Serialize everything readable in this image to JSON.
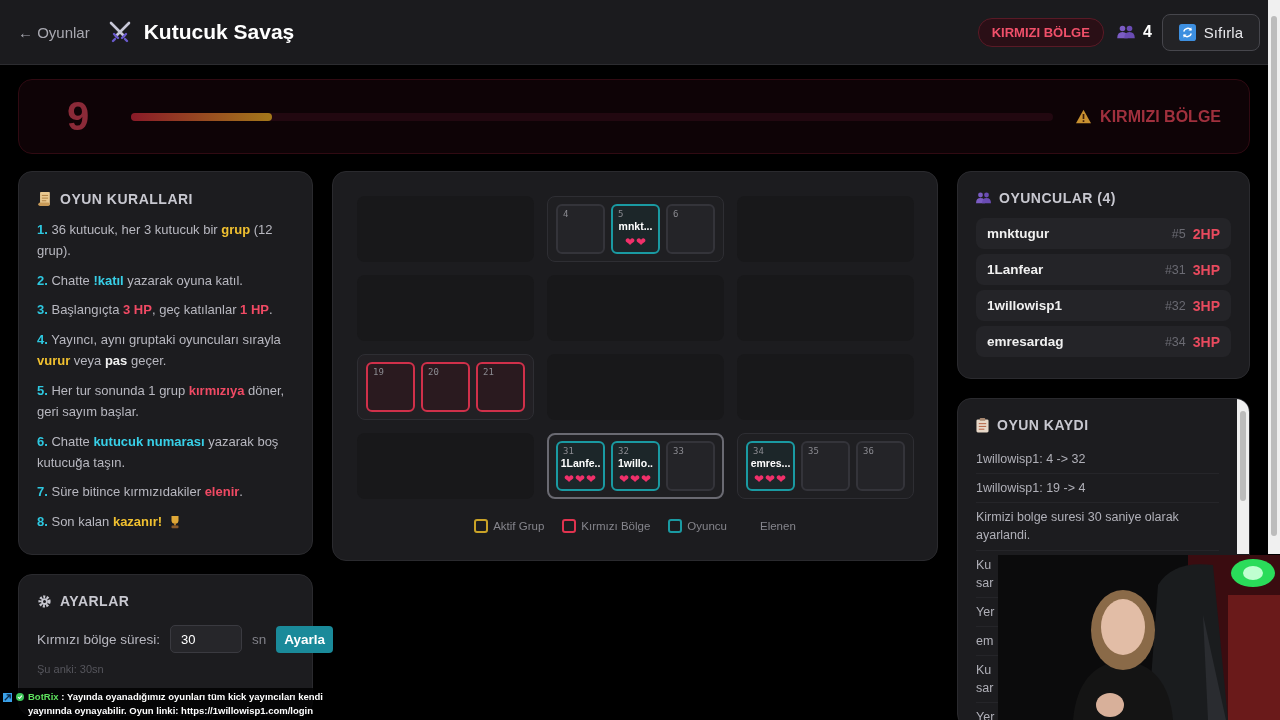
{
  "header": {
    "back_link": "← Oyunlar",
    "title": "Kutucuk Savaş",
    "zone_badge": "KIRMIZI BÖLGE",
    "player_count": "4",
    "reset_button": "Sıfırla"
  },
  "banner": {
    "countdown": "9",
    "level": 0.153,
    "label": "KIRMIZI BÖLGE"
  },
  "rules": {
    "title": "OYUN KURALLARI",
    "items": [
      {
        "number": "1.",
        "parts": [
          {
            "text": "36 kutucuk, her 3 kutucuk bir "
          },
          {
            "text": "grup",
            "color": "#f0c030"
          },
          {
            "text": " (12 grup)."
          }
        ]
      },
      {
        "number": "2.",
        "parts": [
          {
            "text": "Chatte "
          },
          {
            "text": "!katıl",
            "color": "#38d0e8"
          },
          {
            "text": " yazarak oyuna katıl."
          }
        ]
      },
      {
        "number": "3.",
        "parts": [
          {
            "text": "Başlangıçta "
          },
          {
            "text": "3 HP",
            "color": "#f04a64"
          },
          {
            "text": ", geç katılanlar "
          },
          {
            "text": "1 HP",
            "color": "#f04a64"
          },
          {
            "text": "."
          }
        ]
      },
      {
        "number": "4.",
        "parts": [
          {
            "text": "Yayıncı, aynı gruptaki oyuncuları sırayla "
          },
          {
            "text": "vurur",
            "color": "#f0c030"
          },
          {
            "text": " veya "
          },
          {
            "text": "pas",
            "color": "#f0f0f0"
          },
          {
            "text": " geçer."
          }
        ]
      },
      {
        "number": "5.",
        "parts": [
          {
            "text": "Her tur sonunda 1 grup "
          },
          {
            "text": "kırmızıya",
            "color": "#f04a64"
          },
          {
            "text": " döner, geri sayım başlar."
          }
        ]
      },
      {
        "number": "6.",
        "parts": [
          {
            "text": "Chatte "
          },
          {
            "text": "kutucuk numarası",
            "color": "#38d0e8"
          },
          {
            "text": " yazarak boş kutucuğa taşın."
          }
        ]
      },
      {
        "number": "7.",
        "parts": [
          {
            "text": "Süre bitince kırmızıdakiler "
          },
          {
            "text": "elenir",
            "color": "#f04a64"
          },
          {
            "text": "."
          }
        ]
      },
      {
        "number": "8.",
        "parts": [
          {
            "text": "Son kalan "
          },
          {
            "text": "kazanır!",
            "color": "#f0c030"
          }
        ]
      }
    ]
  },
  "settings": {
    "title": "AYARLAR",
    "label": "Kırmızı bölge süresi:",
    "value": "30",
    "unit": "sn",
    "button": "Ayarla",
    "current": "Şu anki: 30sn"
  },
  "board": {
    "groups": [
      {
        "kind": "eliminated",
        "selected": false
      },
      {
        "kind": "normal",
        "selected": false,
        "cells": [
          {
            "number": "4"
          },
          {
            "number": "5",
            "player": "mnkt...",
            "hearts": "❤❤"
          },
          {
            "number": "6"
          }
        ]
      },
      {
        "kind": "eliminated",
        "selected": false
      },
      {
        "kind": "eliminated",
        "selected": false
      },
      {
        "kind": "eliminated",
        "selected": false
      },
      {
        "kind": "eliminated",
        "selected": false
      },
      {
        "kind": "red",
        "selected": false,
        "cells": [
          {
            "number": "19"
          },
          {
            "number": "20"
          },
          {
            "number": "21"
          }
        ]
      },
      {
        "kind": "eliminated",
        "selected": false
      },
      {
        "kind": "eliminated",
        "selected": false
      },
      {
        "kind": "eliminated",
        "selected": false
      },
      {
        "kind": "normal",
        "selected": true,
        "cells": [
          {
            "number": "31",
            "player": "1Lanfe..",
            "hearts": "❤❤❤"
          },
          {
            "number": "32",
            "player": "1willo..",
            "hearts": "❤❤❤"
          },
          {
            "number": "33"
          }
        ]
      },
      {
        "kind": "normal",
        "selected": false,
        "cells": [
          {
            "number": "34",
            "player": "emres...",
            "hearts": "❤❤❤"
          },
          {
            "number": "35"
          },
          {
            "number": "36"
          }
        ]
      }
    ],
    "legend": [
      {
        "label": "Aktif Grup",
        "color": "#c9a227"
      },
      {
        "label": "Kırmızı Bölge",
        "color": "#e0334f"
      },
      {
        "label": "Oyuncu",
        "color": "#1a9aa2"
      },
      {
        "label": "Elenen"
      }
    ]
  },
  "players": {
    "title": "OYUNCULAR (4)",
    "items": [
      {
        "name": "mnktugur",
        "slot": "#5",
        "hp": "2HP"
      },
      {
        "name": "1Lanfear",
        "slot": "#31",
        "hp": "3HP"
      },
      {
        "name": "1willowisp1",
        "slot": "#32",
        "hp": "3HP"
      },
      {
        "name": "emresardag",
        "slot": "#34",
        "hp": "3HP"
      }
    ]
  },
  "log": {
    "title": "OYUN KAYDI",
    "entries": [
      "1willowisp1: 4 -> 32",
      "1willowisp1: 19 -> 4",
      "Kirmizi bolge suresi 30 saniye olarak ayarlandi.",
      "Ku\nsar",
      "Yer",
      "em",
      "Ku\nsar",
      "Yer"
    ]
  },
  "chat": {
    "user": "BotRix",
    "message": ": Yayında oyanadığımız oyunları tüm kick yayıncıları kendi yayınında oynayabilir. Oyun linki: https://1willowisp1.com/login"
  }
}
